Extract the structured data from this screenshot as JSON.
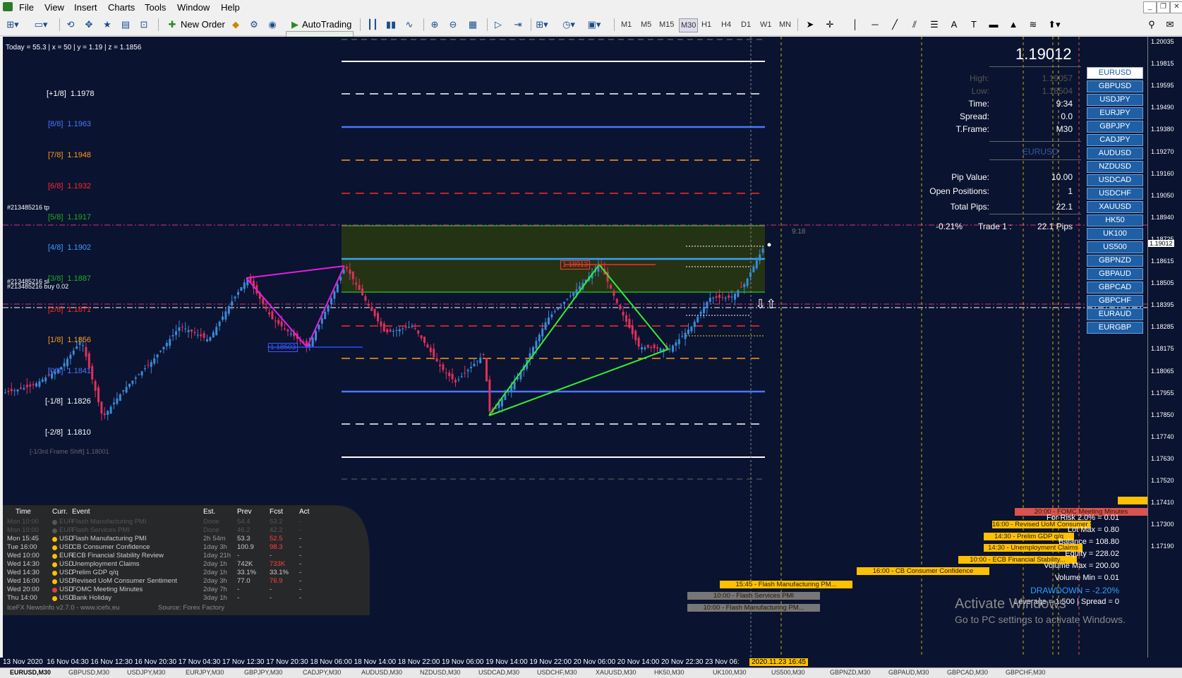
{
  "menu": {
    "items": [
      "File",
      "View",
      "Insert",
      "Charts",
      "Tools",
      "Window",
      "Help"
    ]
  },
  "window_controls": [
    "_",
    "❐",
    "✕"
  ],
  "toolbar": {
    "new_order_label": "New Order",
    "autotrading_label": "AutoTrading",
    "timeframes": [
      "M1",
      "M5",
      "M15",
      "M30",
      "H1",
      "H4",
      "D1",
      "W1",
      "MN"
    ],
    "active_timeframe": "M30"
  },
  "chart": {
    "background": "#0a1330",
    "info_line": "Today = 55.3   |   x = 50   |   y = 1.19   |   z = 1.1856",
    "murrey_levels": [
      {
        "label": "[+1/8]",
        "value": "1.1978",
        "color": "#ffffff"
      },
      {
        "label": "[8/8]",
        "value": "1.1963",
        "color": "#4a78ff"
      },
      {
        "label": "[7/8]",
        "value": "1.1948",
        "color": "#ff9a1a"
      },
      {
        "label": "[6/8]",
        "value": "1.1932",
        "color": "#ff2a2a"
      },
      {
        "label": "[5/8]",
        "value": "1.1917",
        "color": "#22aa22"
      },
      {
        "label": "[4/8]",
        "value": "1.1902",
        "color": "#3aa0ff"
      },
      {
        "label": "[3/8]",
        "value": "1.1887",
        "color": "#22aa22"
      },
      {
        "label": "[2/8]",
        "value": "1.1871",
        "color": "#ff2a2a"
      },
      {
        "label": "[1/8]",
        "value": "1.1856",
        "color": "#ff9a1a"
      },
      {
        "label": "[0/8]",
        "value": "1.1841",
        "color": "#4a78ff"
      },
      {
        "label": "[-1/8]",
        "value": "1.1826",
        "color": "#ffffff"
      },
      {
        "label": "[-2/8]",
        "value": "1.1810",
        "color": "#ffffff"
      }
    ],
    "frame_shift_label": "[-1/3rd Frame Shift]  1.18001",
    "order_tp_label": "#213485216 tp",
    "order_sl_label": "#213485216 sl",
    "order_buy_label": "#213485216 buy 0.02",
    "price_tag_1": "1.18913",
    "price_tag_2": "1.18503",
    "countdown": "9:18",
    "activate_title": "Activate Windows",
    "activate_sub": "Go to PC settings to activate Windows."
  },
  "info_panel": {
    "bid": "1.19012",
    "rows": [
      {
        "label": "High:",
        "value": "1.19057"
      },
      {
        "label": "Low:",
        "value": "1.18504"
      },
      {
        "label": "Time:",
        "value": "9:34"
      },
      {
        "label": "Spread:",
        "value": "0.0"
      },
      {
        "label": "T.Frame:",
        "value": "M30"
      }
    ],
    "symbol": "EURUSD",
    "pip_value_label": "Pip Value:",
    "pip_value": "10.00",
    "open_positions_label": "Open Positions:",
    "open_positions": "1",
    "total_pips_label": "Total Pips:",
    "total_pips": "22.1",
    "trade_pct": "-0.21%",
    "trade_label": "Trade 1 :",
    "trade_pips": "22.1 Pips"
  },
  "symbol_buttons": [
    "EURUSD",
    "GBPUSD",
    "USDJPY",
    "EURJPY",
    "GBPJPY",
    "CADJPY",
    "AUDUSD",
    "NZDUSD",
    "USDCAD",
    "USDCHF",
    "XAUUSD",
    "HK50",
    "UK100",
    "US500",
    "GBPNZD",
    "GBPAUD",
    "GBPCAD",
    "GBPCHF",
    "EURAUD",
    "EURGBP"
  ],
  "price_axis": [
    "1.20035",
    "1.19815",
    "1.19595",
    "1.19490",
    "1.19380",
    "1.19270",
    "1.19160",
    "1.19050",
    "1.19012",
    "1.18940",
    "1.18725",
    "1.18615",
    "1.18505",
    "1.18395",
    "1.18285",
    "1.18175",
    "1.18065",
    "1.17955",
    "1.17850",
    "1.17740",
    "1.17630",
    "1.17520",
    "1.17410",
    "1.17300",
    "1.17190"
  ],
  "current_price": "1.19012",
  "time_axis": [
    "13 Nov 2020",
    "16 Nov 04:30",
    "16 Nov 12:30",
    "16 Nov 20:30",
    "17 Nov 04:30",
    "17 Nov 12:30",
    "17 Nov 20:30",
    "18 Nov 06:00",
    "18 Nov 14:00",
    "18 Nov 22:00",
    "19 Nov 06:00",
    "19 Nov 14:00",
    "19 Nov 22:00",
    "20 Nov 06:00",
    "20 Nov 14:00",
    "20 Nov 22:30",
    "23 Nov 06:"
  ],
  "time_cursor": "2020.11.23 16:45",
  "news_table": {
    "headers": [
      "Time",
      "Curr.",
      "Event",
      "Est.",
      "Prev",
      "Fcst",
      "Act"
    ],
    "rows": [
      {
        "time": "Mon 10:00",
        "curr": "EUR",
        "event": "Flash Manufacturing PMI",
        "est": "Done",
        "prev": "54.4",
        "fcst": "53.2",
        "act": "-",
        "dot": "#555555",
        "dim": true
      },
      {
        "time": "Mon 10:00",
        "curr": "EUR",
        "event": "Flash Services PMI",
        "est": "Done",
        "prev": "46.2",
        "fcst": "42.2",
        "act": "-",
        "dot": "#555555",
        "dim": true
      },
      {
        "time": "Mon 15:45",
        "curr": "USD",
        "event": "Flash Manufacturing PMI",
        "est": "2h 54m",
        "prev": "53.3",
        "fcst": "52.5",
        "act": "-",
        "dot": "#ffc000",
        "dim": false
      },
      {
        "time": "Tue 16:00",
        "curr": "USD",
        "event": "CB Consumer Confidence",
        "est": "1day 3h",
        "prev": "100.9",
        "fcst": "98.3",
        "act": "-",
        "dot": "#ffc000",
        "dim": false
      },
      {
        "time": "Wed 10:00",
        "curr": "EUR",
        "event": "ECB Financial Stability Review",
        "est": "1day 21h",
        "prev": "-",
        "fcst": "-",
        "act": "-",
        "dot": "#ffc000",
        "dim": false
      },
      {
        "time": "Wed 14:30",
        "curr": "USD",
        "event": "Unemployment Claims",
        "est": "2day 1h",
        "prev": "742K",
        "fcst": "733K",
        "act": "-",
        "dot": "#ffc000",
        "dim": false
      },
      {
        "time": "Wed 14:30",
        "curr": "USD",
        "event": "Prelim GDP q/q",
        "est": "2day 1h",
        "prev": "33.1%",
        "fcst": "33.1%",
        "act": "-",
        "dot": "#ffc000",
        "dim": false
      },
      {
        "time": "Wed 16:00",
        "curr": "USD",
        "event": "Revised UoM Consumer Sentiment",
        "est": "2day 3h",
        "prev": "77.0",
        "fcst": "76.9",
        "act": "-",
        "dot": "#ffc000",
        "dim": false
      },
      {
        "time": "Wed 20:00",
        "curr": "USD",
        "event": "FOMC Meeting Minutes",
        "est": "2day 7h",
        "prev": "-",
        "fcst": "-",
        "act": "-",
        "dot": "#e04040",
        "dim": false
      },
      {
        "time": "Thu 14:00",
        "curr": "USD",
        "event": "Bank Holiday",
        "est": "3day 1h",
        "prev": "-",
        "fcst": "-",
        "act": "-",
        "dot": "#ffc000",
        "dim": false
      }
    ],
    "footer_left": "IceFX NewsInfo v2.7.0  -  www.icefx.eu",
    "footer_right": "Source: Forex Factory"
  },
  "news_bars": [
    {
      "text": "20:00 - FOMC Meeting Minutes",
      "color": "#d9534f"
    },
    {
      "text": "16:00 - Revised UoM Consumer S...",
      "color": "#ffc000"
    },
    {
      "text": "14:30 - Prelim GDP q/q",
      "color": "#ffc000"
    },
    {
      "text": "14:30 - Unemployment Claims",
      "color": "#ffc000"
    },
    {
      "text": "10:00 - ECB Financial Stability...",
      "color": "#ffc000"
    },
    {
      "text": "16:00 - CB Consumer Confidence",
      "color": "#ffc000"
    },
    {
      "text": "15:45 - Flash Manufacturing PM...",
      "color": "#ffc000"
    },
    {
      "text": "10:00 - Flash Services PMI",
      "color": "#777777"
    },
    {
      "text": "10:00 - Flash Manufacturing PM...",
      "color": "#777777"
    }
  ],
  "risk_panel": [
    "For Risk 2.0% = 0.01",
    "Lot Max = 0.80",
    "Balance = 108.80",
    "Equity = 228.02",
    "Volume Max = 200.00",
    "Volume Min = 0.01",
    "DRAWDOWN = -2.20%",
    "Leverage = 1:500 | Spread = 0"
  ],
  "tabs": [
    "EURUSD,M30",
    "GBPUSD,M30",
    "USDJPY,M30",
    "EURJPY,M30",
    "GBPJPY,M30",
    "CADJPY,M30",
    "AUDUSD,M30",
    "NZDUSD,M30",
    "USDCAD,M30",
    "USDCHF,M30",
    "XAUUSD,M30",
    "HK50,M30",
    "UK100,M30",
    "US500,M30",
    "GBPNZD,M30",
    "GBPAUD,M30",
    "GBPCAD,M30",
    "GBPCHF,M30"
  ]
}
